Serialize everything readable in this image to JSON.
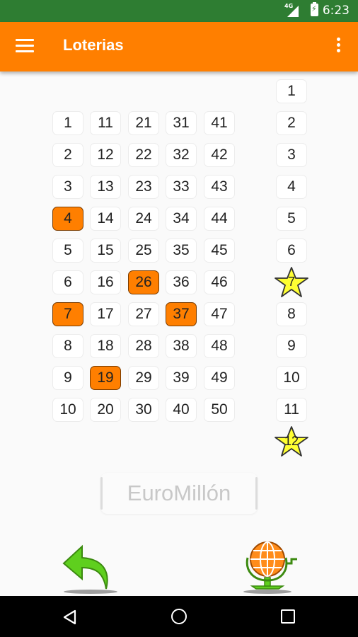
{
  "status_bar": {
    "time": "6:23",
    "network": "4G",
    "battery_icon": "battery-charging-icon"
  },
  "app_bar": {
    "title": "Loterias",
    "menu_icon": "hamburger-menu-icon",
    "overflow_icon": "more-vert-icon"
  },
  "colors": {
    "accent": "#ff7f00",
    "status_bar": "#2e7d32",
    "selected_border": "#7a3c00",
    "star": "#ffff33"
  },
  "numbers": {
    "columns": [
      [
        "1",
        "2",
        "3",
        "4",
        "5",
        "6",
        "7",
        "8",
        "9",
        "10"
      ],
      [
        "11",
        "12",
        "13",
        "14",
        "15",
        "16",
        "17",
        "18",
        "19",
        "20"
      ],
      [
        "21",
        "22",
        "23",
        "24",
        "25",
        "26",
        "27",
        "28",
        "29",
        "30"
      ],
      [
        "31",
        "32",
        "33",
        "34",
        "35",
        "36",
        "37",
        "38",
        "39",
        "40"
      ],
      [
        "41",
        "42",
        "43",
        "44",
        "45",
        "46",
        "47",
        "48",
        "49",
        "50"
      ]
    ],
    "selected": [
      "4",
      "7",
      "19",
      "26",
      "37"
    ]
  },
  "stars": {
    "items": [
      "1",
      "2",
      "3",
      "4",
      "5",
      "6",
      "7",
      "8",
      "9",
      "10",
      "11",
      "12"
    ],
    "selected": [
      "7",
      "12"
    ]
  },
  "game_button": {
    "label": "EuroMillón"
  },
  "bottom_actions": {
    "back_icon": "undo-arrow-icon",
    "draw_icon": "lottery-globe-icon"
  },
  "nav_bar": {
    "back_icon": "nav-back-icon",
    "home_icon": "nav-home-icon",
    "recents_icon": "nav-recents-icon"
  }
}
